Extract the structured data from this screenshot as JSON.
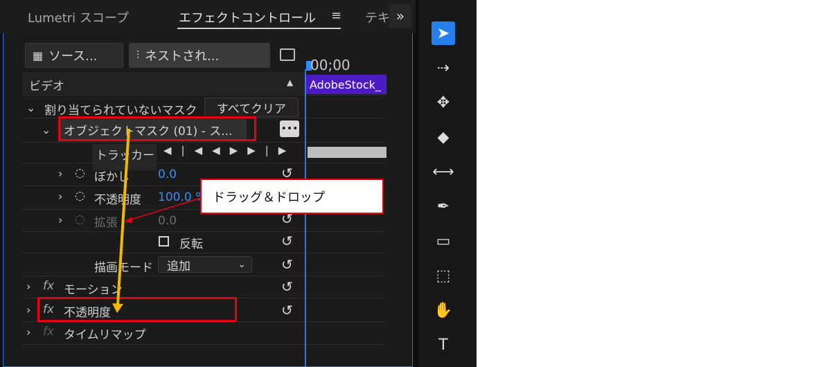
{
  "tabs": [
    {
      "label": "Lumetri スコープ"
    },
    {
      "label": "エフェクトコントロール"
    },
    {
      "label": "テキ"
    }
  ],
  "source_button": {
    "label": "ソース..."
  },
  "nested_button": {
    "label": "ネストされ..."
  },
  "timeline": {
    "timecode": "00;00",
    "clip_label": "AdobeStock_"
  },
  "section_video": "ビデオ",
  "unassigned_mask": {
    "label": "割り当てられていないマスク",
    "clear_label": "すべてクリア"
  },
  "object_mask": {
    "label": "オブジェクトマスク (01) - ス..."
  },
  "tracker": {
    "label": "トラッカー"
  },
  "properties": [
    {
      "label": "ぼかし",
      "value": "0.0"
    },
    {
      "label": "不透明度",
      "value": "100.0 %"
    },
    {
      "label": "拡張",
      "value": "0.0"
    }
  ],
  "invert": {
    "label": "反転"
  },
  "blend_mode": {
    "label": "描画モード",
    "value": "追加"
  },
  "effects": [
    {
      "label": "モーション"
    },
    {
      "label": "不透明度"
    },
    {
      "label": "タイムリマップ"
    }
  ],
  "annotation": {
    "text": "ドラッグ＆ドロップ"
  },
  "icons": {
    "menu": "hamburger-icon",
    "overflow": "double-chevron-right-icon",
    "source": "film-icon",
    "nested": "nest-icon",
    "panel": "panel-layout-icon",
    "comment": "comment-icon",
    "reset": "reset-icon",
    "stopwatch": "stopwatch-icon"
  },
  "colors": {
    "accent": "#2680eb",
    "clip": "#4b1bc4",
    "highlight": "#e60012",
    "arrow": "#f5b800",
    "value": "#3e8cf0"
  }
}
